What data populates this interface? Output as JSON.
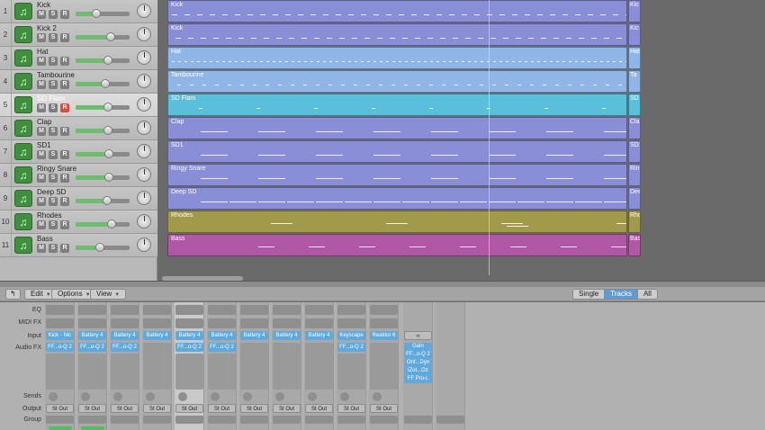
{
  "tracks": [
    {
      "num": "1",
      "name": "Kick",
      "fader": 0.38,
      "selected": false,
      "rec": false
    },
    {
      "num": "2",
      "name": "Kick 2",
      "fader": 0.65,
      "selected": false,
      "rec": false
    },
    {
      "num": "3",
      "name": "Hat",
      "fader": 0.6,
      "selected": false,
      "rec": false
    },
    {
      "num": "4",
      "name": "Tambourine",
      "fader": 0.55,
      "selected": false,
      "rec": false
    },
    {
      "num": "5",
      "name": "SD Flam",
      "fader": 0.6,
      "selected": true,
      "rec": true
    },
    {
      "num": "6",
      "name": "Clap",
      "fader": 0.6,
      "selected": false,
      "rec": false
    },
    {
      "num": "7",
      "name": "SD1",
      "fader": 0.62,
      "selected": false,
      "rec": false
    },
    {
      "num": "8",
      "name": "Ringy Snare",
      "fader": 0.62,
      "selected": false,
      "rec": false
    },
    {
      "num": "9",
      "name": "Deep SD",
      "fader": 0.58,
      "selected": false,
      "rec": false
    },
    {
      "num": "10",
      "name": "Rhodes",
      "fader": 0.66,
      "selected": false,
      "rec": false
    },
    {
      "num": "11",
      "name": "Bass",
      "fader": 0.45,
      "selected": false,
      "rec": false
    }
  ],
  "msr_labels": {
    "mute": "M",
    "solo": "S",
    "record": "R"
  },
  "regions": [
    {
      "name": "Kick",
      "tail": "Kic",
      "color": "#8a8ed6"
    },
    {
      "name": "Kick",
      "tail": "Kic",
      "color": "#8a8ed6"
    },
    {
      "name": "Hat",
      "tail": "Hat",
      "color": "#8fb6e6"
    },
    {
      "name": "Tambourine",
      "tail": "Ta",
      "color": "#8fb6e6"
    },
    {
      "name": "SD Flam",
      "tail": "SD",
      "color": "#59bfdb"
    },
    {
      "name": "Clap",
      "tail": "Cla",
      "color": "#8a8ed6"
    },
    {
      "name": "SD1",
      "tail": "SD1",
      "color": "#8a8ed6"
    },
    {
      "name": "Ringy Snare",
      "tail": "Rin",
      "color": "#8a8ed6"
    },
    {
      "name": "Deep SD",
      "tail": "Dee",
      "color": "#8a8ed6"
    },
    {
      "name": "Rhodes",
      "tail": "Rho",
      "color": "#a19a4a"
    },
    {
      "name": "Bass",
      "tail": "Bas",
      "color": "#b057a6"
    }
  ],
  "toolbar": {
    "edit": "Edit",
    "options": "Options",
    "view": "View",
    "single": "Single",
    "tracks": "Tracks",
    "all": "All",
    "active_view": "Tracks"
  },
  "mixer": {
    "row_labels": {
      "eq": "EQ",
      "midi_fx": "MIDI FX",
      "input": "Input",
      "audio_fx": "Audio FX",
      "sends": "Sends",
      "output": "Output",
      "group": "Group"
    },
    "strips": [
      {
        "input": "Kick - Nic",
        "fx": "FF...o-Q 2",
        "output": "St Out",
        "selected": false,
        "green": true
      },
      {
        "input": "Battery 4",
        "fx": "FF...o-Q 2",
        "output": "St Out",
        "selected": false,
        "green": true
      },
      {
        "input": "Battery 4",
        "fx": "FF...o-Q 2",
        "output": "St Out",
        "selected": false,
        "green": false
      },
      {
        "input": "Battery 4",
        "fx": "",
        "output": "St Out",
        "selected": false,
        "green": false
      },
      {
        "input": "Battery 4",
        "fx": "FF...o-Q 2",
        "output": "St Out",
        "selected": true,
        "green": false
      },
      {
        "input": "Battery 4",
        "fx": "FF...o-Q 2",
        "output": "St Out",
        "selected": false,
        "green": false
      },
      {
        "input": "Battery 4",
        "fx": "",
        "output": "St Out",
        "selected": false,
        "green": false
      },
      {
        "input": "Battery 4",
        "fx": "",
        "output": "St Out",
        "selected": false,
        "green": false
      },
      {
        "input": "Battery 4",
        "fx": "",
        "output": "St Out",
        "selected": false,
        "green": false
      },
      {
        "input": "Keyscape",
        "fx": "FF...o-Q 2",
        "output": "St Out",
        "selected": false,
        "green": false
      },
      {
        "input": "Reaktor 6",
        "fx": "",
        "output": "St Out",
        "selected": false,
        "green": false
      }
    ],
    "master": {
      "input_icon": "link-icon",
      "fx": [
        "Gain",
        "FF...o-Q 2",
        "Onf...Dyn",
        "iZot...Oz",
        "FF Pro-L"
      ]
    }
  }
}
